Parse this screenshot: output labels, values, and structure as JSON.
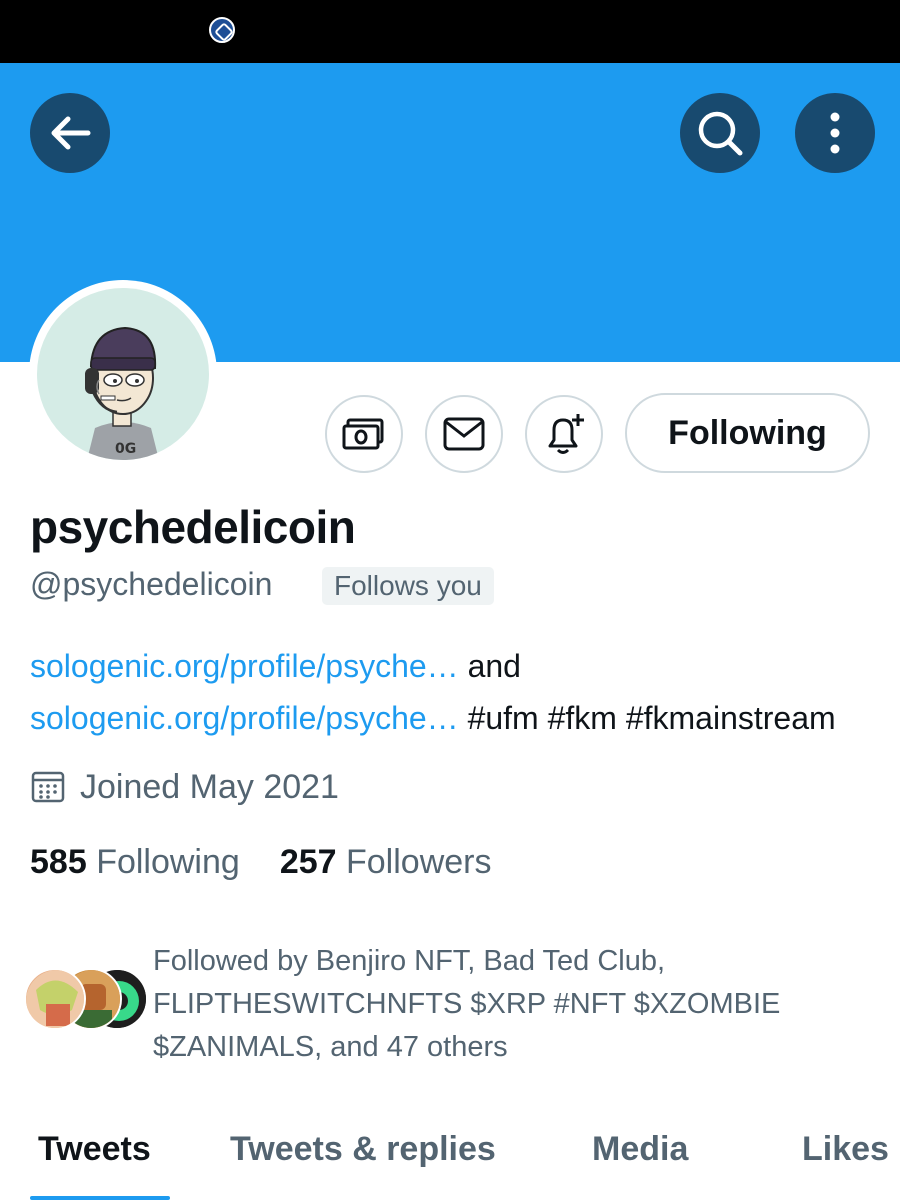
{
  "colors": {
    "banner": "#1d9bf0",
    "link": "#1d9bf0",
    "text_primary": "#0f1419",
    "text_secondary": "#536471",
    "button_dark": "#184a6f"
  },
  "header": {
    "back_icon": "arrow-left-icon",
    "search_icon": "search-icon",
    "more_icon": "more-vertical-icon"
  },
  "profile": {
    "display_name": "psychedelicoin",
    "handle": "@psychedelicoin",
    "follows_you": "Follows you",
    "follow_button": "Following",
    "bio": {
      "link1": "sologenic.org/profile/psyche…",
      "conjunction": " and ",
      "link2": "sologenic.org/profile/psyche…",
      "tags": " #ufm #fkm #fkmainstream"
    },
    "joined": "Joined May 2021",
    "following_count": "585",
    "following_label": "Following",
    "followers_count": "257",
    "followers_label": "Followers",
    "followed_by": "Followed by Benjiro NFT, Bad Ted Club, FLIPTHESWITCHNFTS $XRP #NFT $XZOMBIE $ZANIMALS, and 47 others"
  },
  "action_buttons": {
    "tip_icon": "money-tip-icon",
    "message_icon": "mail-icon",
    "notify_icon": "bell-plus-icon"
  },
  "tabs": [
    {
      "label": "Tweets",
      "active": true
    },
    {
      "label": "Tweets & replies",
      "active": false
    },
    {
      "label": "Media",
      "active": false
    },
    {
      "label": "Likes",
      "active": false
    }
  ]
}
